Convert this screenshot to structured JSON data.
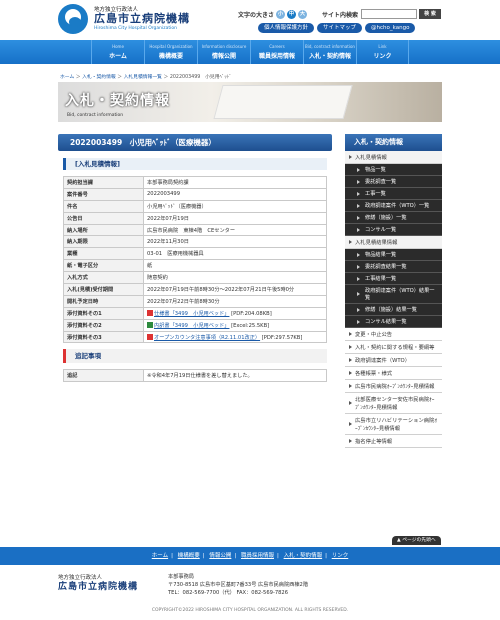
{
  "header": {
    "org_sub": "地方独立行政法人",
    "org_name": "広島市立病院機構",
    "org_en": "Hiroshima City Hospital Organization",
    "font_size_label": "文字の大きさ",
    "font_small": "小",
    "font_medium": "中",
    "font_large": "大",
    "search_label": "サイト内検索",
    "search_button": "検 索",
    "link_privacy": "個人情報保護方針",
    "link_sitemap": "サイトマップ",
    "link_twitter": "@hcho_kango"
  },
  "nav": [
    {
      "en": "Home",
      "ja": "ホーム"
    },
    {
      "en": "Hospital Organization",
      "ja": "機構概要"
    },
    {
      "en": "Information disclosure",
      "ja": "情報公開"
    },
    {
      "en": "Careers",
      "ja": "職員採用情報"
    },
    {
      "en": "Bid, contract information",
      "ja": "入札・契約情報"
    },
    {
      "en": "Link",
      "ja": "リンク"
    }
  ],
  "breadcrumb": {
    "home": "ホーム",
    "bid": "入札・契約情報",
    "list": "入札見積情報一覧",
    "current": "2022003499　小児用ﾍﾞｯﾄﾞ"
  },
  "banner": {
    "title": "入札・契約情報",
    "en": "Bid, contract information"
  },
  "main": {
    "title": "2022003499　小児用ﾍﾞｯﾄﾞ（医療機器）",
    "section": "[入札見積情報]",
    "rows": [
      {
        "label": "契約担当課",
        "value": "本部事務局契約課"
      },
      {
        "label": "案件番号",
        "value": "2022003499"
      },
      {
        "label": "件名",
        "value": "小児用ﾍﾞｯﾄﾞ（医療機器）"
      },
      {
        "label": "公告日",
        "value": "2022年07月19日"
      },
      {
        "label": "納入場所",
        "value": "広島市民病院　東棟4階　CEセンター"
      },
      {
        "label": "納入期限",
        "value": "2022年11月30日"
      },
      {
        "label": "業種",
        "value": "03-01　医療用機械器具"
      },
      {
        "label": "紙・電子区分",
        "value": "紙"
      },
      {
        "label": "入札方式",
        "value": "随意契約"
      },
      {
        "label": "入札(見積)受付期間",
        "value": "2022年07月19日午前8時30分～2022年07月21日午後5時0分"
      },
      {
        "label": "開札予定日時",
        "value": "2022年07月22日午前8時30分"
      }
    ],
    "attachments": [
      {
        "label": "添付資料その1",
        "link": "仕様書「3499　小児用ベッド」",
        "meta": "[PDF:204.08KB]",
        "icon": "pdf-icon"
      },
      {
        "label": "添付資料その2",
        "link": "内訳書「3499　小児用ベッド」",
        "meta": "[Excel:25.5KB]",
        "icon": "excel-icon"
      },
      {
        "label": "添付資料その3",
        "link": "オープンカウンタ注意事項（R2.11.01改正）",
        "meta": "[PDF:297.57KB]",
        "icon": "pdf-icon"
      }
    ],
    "notice_heading": "追記事項",
    "notice_label": "追記",
    "notice_value": "※令和4年7月19日仕様書を差し替えました。"
  },
  "sidebar": {
    "title": "入札・契約情報",
    "group1": "入札見積情報",
    "group1_items": [
      "物品一覧",
      "委託調査一覧",
      "工事一覧",
      "政府調達案件（WTO）一覧",
      "修繕（施設）一覧",
      "コンサル一覧"
    ],
    "group2": "入札見積結果情報",
    "group2_items": [
      "物品結果一覧",
      "委託調査結果一覧",
      "工事結果一覧",
      "政府調達案件（WTO）結果一覧",
      "修繕（施設）結果一覧",
      "コンサル結果一覧"
    ],
    "others": [
      "変更・中止公告",
      "入札・契約に関する規程・要綱等",
      "政府調達案件（WTO）",
      "各種帳票・様式",
      "広島市民病院ｵｰﾌﾟﾝｶｳﾝﾀｰ見積情報",
      "北部医療センター安佐市民病院ｵｰﾌﾟﾝｶｳﾝﾀｰ見積情報",
      "広島市立リハビリテーション病院ｵｰﾌﾟﾝｶｳﾝﾀｰ見積情報",
      "指名停止等情報"
    ]
  },
  "pagetop": "ページの先頭へ",
  "footer": {
    "links": [
      "ホーム",
      "機構概要",
      "情報公開",
      "職員採用情報",
      "入札・契約情報",
      "リンク"
    ],
    "org_sub": "地方独立行政法人",
    "org_name": "広島市立病院機構",
    "office": "本部事務局",
    "address": "〒730-8518 広島市中区基町7番33号 広島市民病院西棟2階",
    "tel": "TEL：082-569-7700（代）  FAX：082-569-7826",
    "copyright": "COPYRIGHT©2022 HIROSHIMA CITY HOSPITAL ORGANIZATION. ALL RIGHTS RESERVED."
  }
}
